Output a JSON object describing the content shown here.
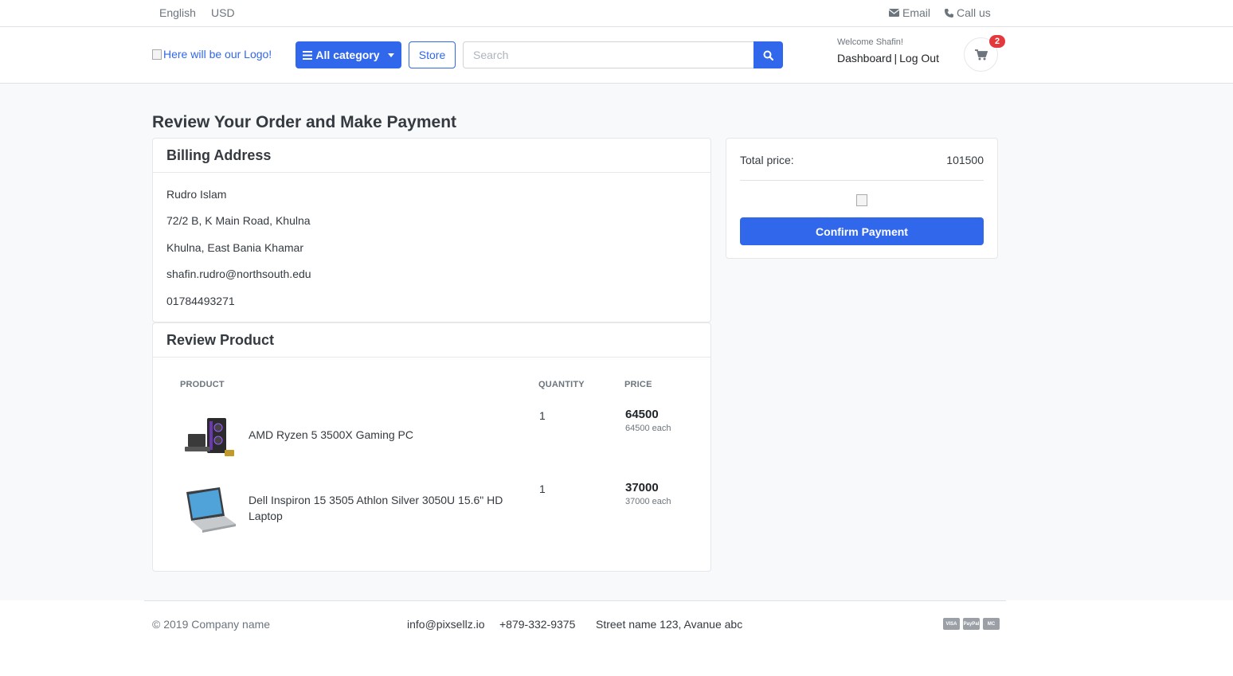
{
  "topbar": {
    "language": "English",
    "currency": "USD",
    "email_label": "Email",
    "call_label": "Call us"
  },
  "header": {
    "logo_alt": "Here will be our Logo!",
    "category_button": "All category",
    "store_button": "Store",
    "search_placeholder": "Search",
    "welcome": "Welcome Shafin!",
    "dashboard_link": "Dashboard",
    "separator": "|",
    "logout_link": "Log Out",
    "cart_count": "2"
  },
  "page": {
    "title": "Review Your Order and Make Payment"
  },
  "billing": {
    "heading": "Billing Address",
    "name": "Rudro Islam",
    "address_line1": "72/2 B, K Main Road, Khulna",
    "address_line2": "Khulna, East Bania Khamar",
    "email": "shafin.rudro@northsouth.edu",
    "phone": "01784493271"
  },
  "review": {
    "heading": "Review Product",
    "columns": [
      "Product",
      "Quantity",
      "Price"
    ],
    "items": [
      {
        "name": "AMD Ryzen 5 3500X Gaming PC",
        "quantity": "1",
        "price": "64500",
        "each": "64500 each",
        "icon": "gaming-pc-icon"
      },
      {
        "name": "Dell Inspiron 15 3505 Athlon Silver 3050U 15.6\" HD Laptop",
        "quantity": "1",
        "price": "37000",
        "each": "37000 each",
        "icon": "laptop-icon"
      }
    ]
  },
  "summary": {
    "total_label": "Total price:",
    "total_value": "101500",
    "confirm_button": "Confirm Payment"
  },
  "footer": {
    "copyright": "© 2019 Company name",
    "email": "info@pixsellz.io",
    "phone": "+879-332-9375",
    "address": "Street name 123, Avanue abc",
    "payment_icons": [
      "VISA",
      "PayPal",
      "MC"
    ]
  },
  "colors": {
    "primary": "#3167eb",
    "badge": "#e4393c",
    "background": "#f8f9fa"
  }
}
